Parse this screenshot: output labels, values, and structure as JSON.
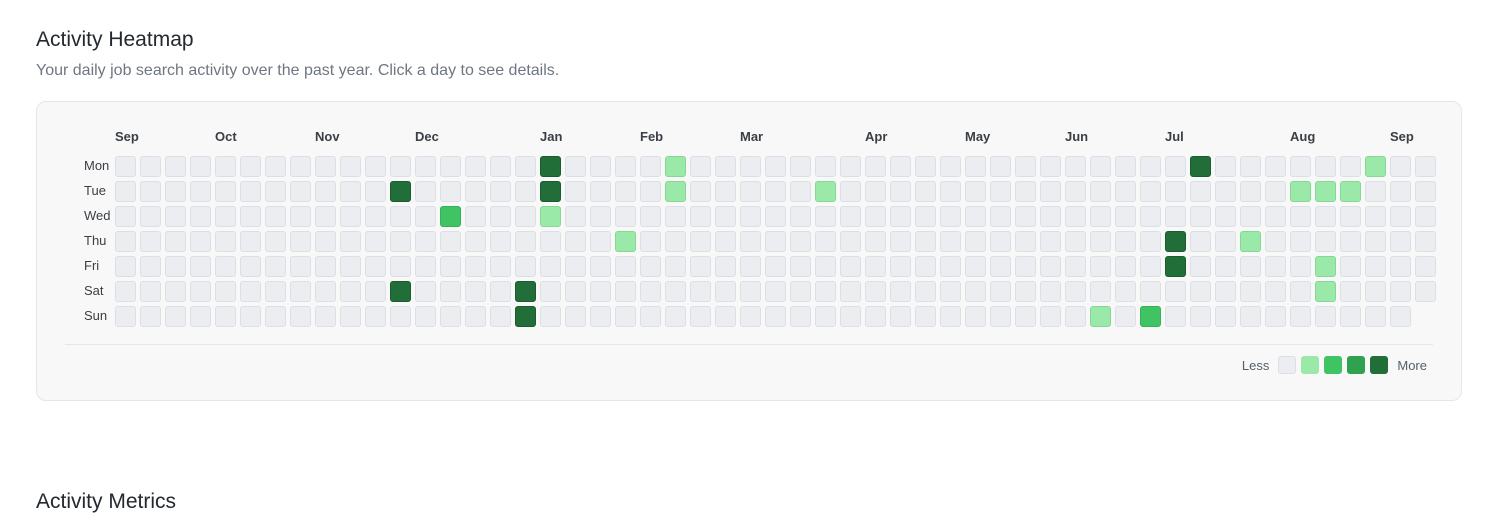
{
  "heatmap": {
    "title": "Activity Heatmap",
    "subtitle": "Your daily job search activity over the past year. Click a day to see details.",
    "months": [
      {
        "label": "Sep",
        "week": 0
      },
      {
        "label": "Oct",
        "week": 4
      },
      {
        "label": "Nov",
        "week": 8
      },
      {
        "label": "Dec",
        "week": 12
      },
      {
        "label": "Jan",
        "week": 17
      },
      {
        "label": "Feb",
        "week": 21
      },
      {
        "label": "Mar",
        "week": 25
      },
      {
        "label": "Apr",
        "week": 30
      },
      {
        "label": "May",
        "week": 34
      },
      {
        "label": "Jun",
        "week": 38
      },
      {
        "label": "Jul",
        "week": 42
      },
      {
        "label": "Aug",
        "week": 47
      },
      {
        "label": "Sep",
        "week": 51
      }
    ],
    "days": [
      "Mon",
      "Tue",
      "Wed",
      "Thu",
      "Fri",
      "Sat",
      "Sun"
    ],
    "weeks": 53,
    "sun_weeks": 52,
    "levels": {
      "0": "#ebedf0",
      "1": "#9be9a8",
      "2": "#40c463",
      "3": "#30a14e",
      "4": "#216e39"
    },
    "active_days": [
      {
        "week": 17,
        "day": 0,
        "level": 4
      },
      {
        "week": 22,
        "day": 0,
        "level": 1
      },
      {
        "week": 43,
        "day": 0,
        "level": 4
      },
      {
        "week": 50,
        "day": 0,
        "level": 1
      },
      {
        "week": 11,
        "day": 1,
        "level": 4
      },
      {
        "week": 17,
        "day": 1,
        "level": 4
      },
      {
        "week": 22,
        "day": 1,
        "level": 1
      },
      {
        "week": 28,
        "day": 1,
        "level": 1
      },
      {
        "week": 47,
        "day": 1,
        "level": 1
      },
      {
        "week": 48,
        "day": 1,
        "level": 1
      },
      {
        "week": 49,
        "day": 1,
        "level": 1
      },
      {
        "week": 13,
        "day": 2,
        "level": 2
      },
      {
        "week": 17,
        "day": 2,
        "level": 1
      },
      {
        "week": 20,
        "day": 3,
        "level": 1
      },
      {
        "week": 42,
        "day": 3,
        "level": 4
      },
      {
        "week": 45,
        "day": 3,
        "level": 1
      },
      {
        "week": 42,
        "day": 4,
        "level": 4
      },
      {
        "week": 48,
        "day": 4,
        "level": 1
      },
      {
        "week": 11,
        "day": 5,
        "level": 4
      },
      {
        "week": 16,
        "day": 5,
        "level": 4
      },
      {
        "week": 48,
        "day": 5,
        "level": 1
      },
      {
        "week": 16,
        "day": 6,
        "level": 4
      },
      {
        "week": 39,
        "day": 6,
        "level": 1
      },
      {
        "week": 41,
        "day": 6,
        "level": 2
      }
    ],
    "legend": {
      "less": "Less",
      "more": "More"
    }
  },
  "metrics": {
    "title": "Activity Metrics"
  }
}
